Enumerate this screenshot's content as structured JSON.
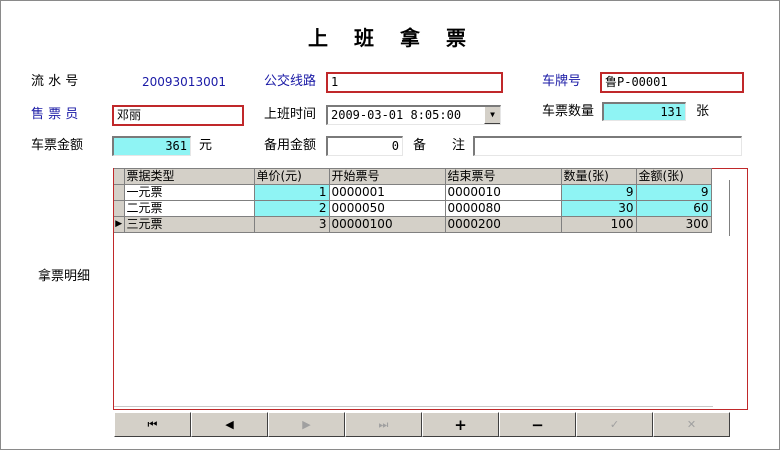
{
  "form": {
    "title": "上班拿票",
    "serial": {
      "label": "流 水 号",
      "value": "20093013001"
    },
    "route": {
      "label": "公交线路",
      "value": "1"
    },
    "plate": {
      "label": "车牌号",
      "value": "鲁P-00001"
    },
    "seller": {
      "label": "售 票 员",
      "value": "邓丽"
    },
    "shift_time": {
      "label": "上班时间",
      "value": "2009-03-01 8:05:00"
    },
    "ticket_count": {
      "label": "车票数量",
      "value": "131",
      "unit": "张"
    },
    "ticket_amount": {
      "label": "车票金额",
      "value": "361",
      "unit": "元"
    },
    "spare_amount": {
      "label": "备用金额",
      "value": "0"
    },
    "note": {
      "label": "备　　注",
      "value": ""
    },
    "detail_label": "拿票明细"
  },
  "grid": {
    "columns": [
      "票据类型",
      "单价(元)",
      "开始票号",
      "结束票号",
      "数量(张)",
      "金额(张)"
    ],
    "rows": [
      {
        "type": "一元票",
        "price": "1",
        "start": "0000001",
        "end": "0000010",
        "qty": "9",
        "amount": "9"
      },
      {
        "type": "二元票",
        "price": "2",
        "start": "0000050",
        "end": "0000080",
        "qty": "30",
        "amount": "60"
      },
      {
        "type": "三元票",
        "price": "3",
        "start": "00000100",
        "end": "0000200",
        "qty": "100",
        "amount": "300"
      }
    ],
    "current_row_marker": "▶"
  },
  "navigator": {
    "first": "⏮",
    "prior": "◀",
    "next": "▶",
    "last": "⏭",
    "insert": "+",
    "delete": "−",
    "post": "✓",
    "cancel": "✕"
  },
  "colors": {
    "accent_border": "#c0282a",
    "highlight": "#8ff4f4",
    "label_blue": "#1a1aa6"
  }
}
